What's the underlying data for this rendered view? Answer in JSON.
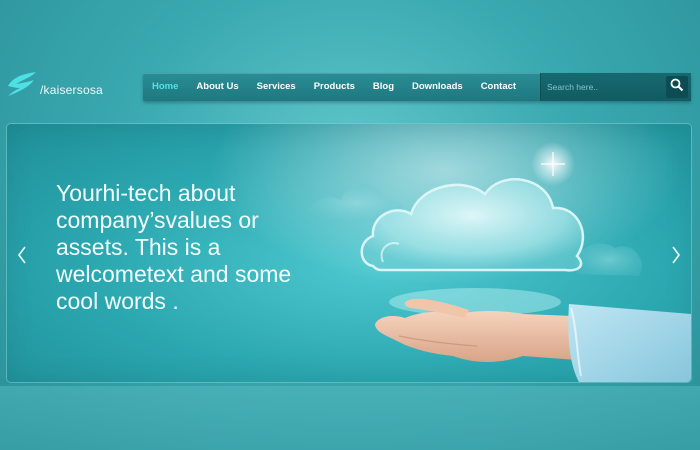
{
  "brand": {
    "name": "/kaisersosa",
    "logo_icon": "wave-logo-icon"
  },
  "nav": {
    "items": [
      {
        "label": "Home",
        "active": true
      },
      {
        "label": "About Us",
        "active": false
      },
      {
        "label": "Services",
        "active": false
      },
      {
        "label": "Products",
        "active": false
      },
      {
        "label": "Blog",
        "active": false
      },
      {
        "label": "Downloads",
        "active": false
      },
      {
        "label": "Contact",
        "active": false
      }
    ],
    "search": {
      "placeholder": "Search here..",
      "icon": "search-icon"
    }
  },
  "slider": {
    "headline": "Yourhi-tech about company’svalues or assets. This is a welcometext and some cool words .",
    "prev_icon": "chevron-left-icon",
    "next_icon": "chevron-right-icon",
    "art": "cloud-on-hand-illustration"
  },
  "colors": {
    "accent": "#4fe2e6",
    "nav_bg": "#2a8d95",
    "background": "#3aa9b0"
  }
}
